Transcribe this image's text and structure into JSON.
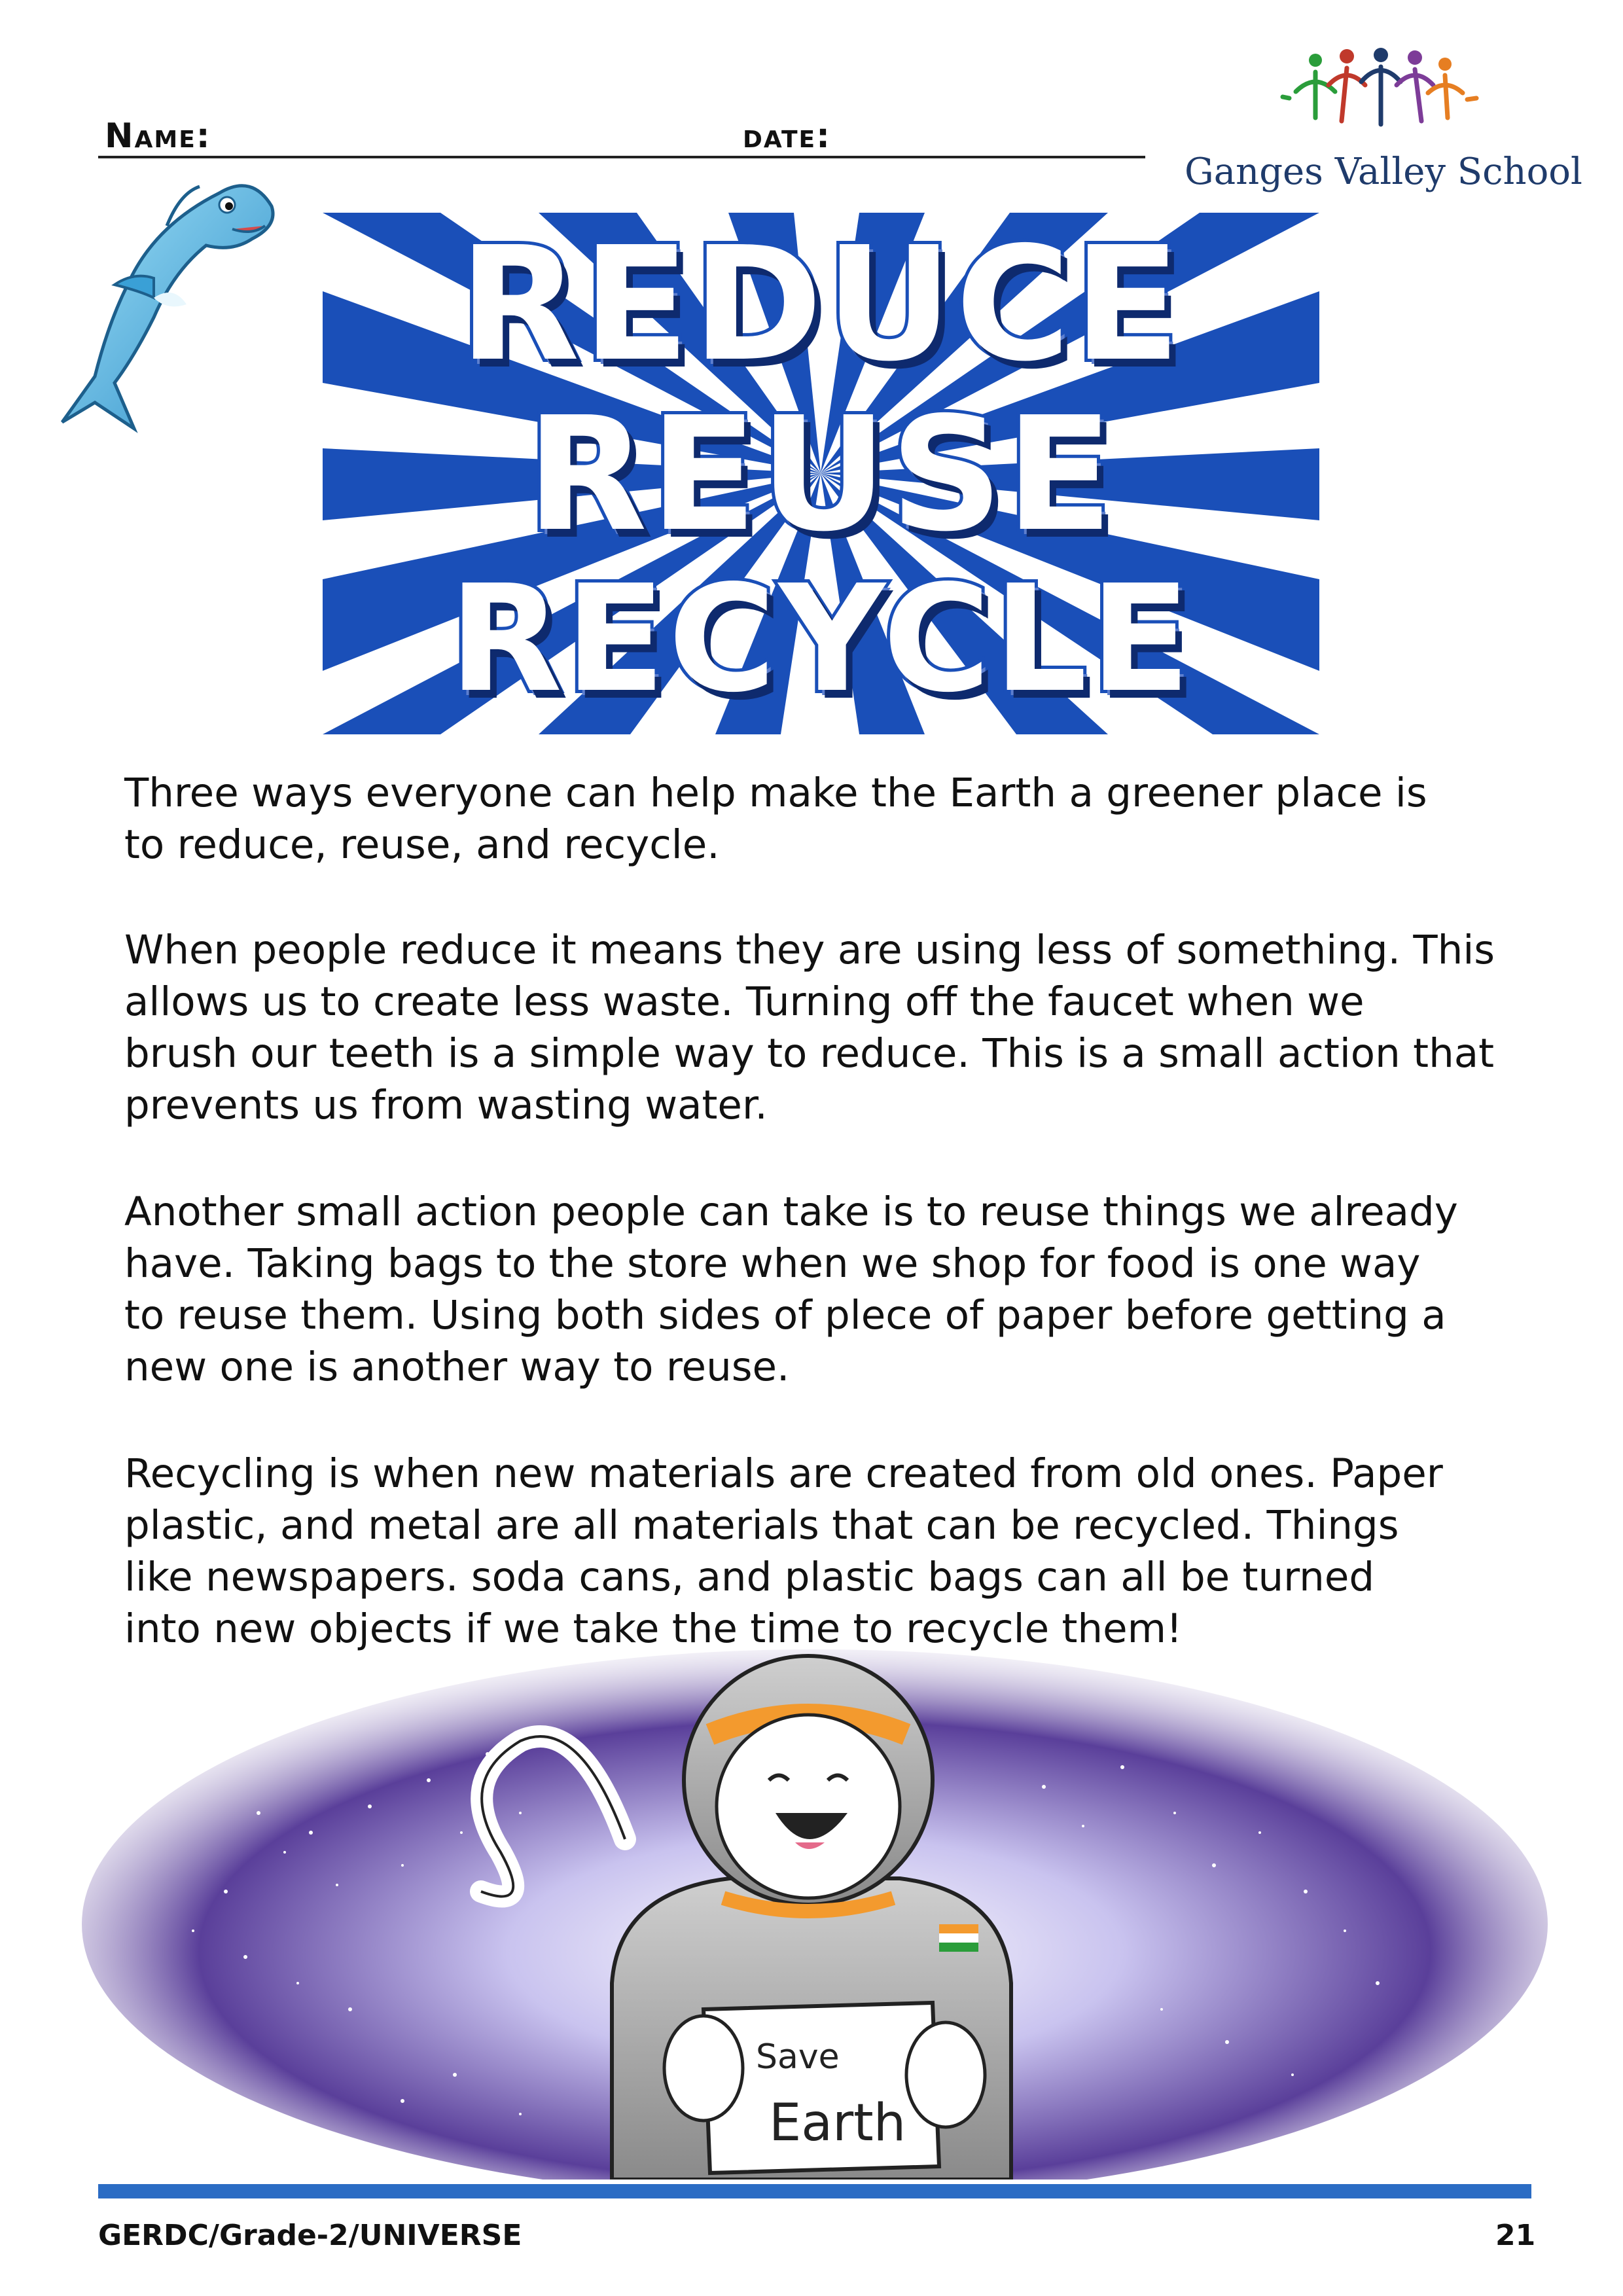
{
  "header": {
    "name_label": "Name:",
    "date_label": "date:"
  },
  "logo": {
    "school_name": "Ganges Valley School"
  },
  "banner": {
    "words": [
      "REDUCE",
      "REUSE",
      "RECYCLE"
    ]
  },
  "paragraphs": [
    [
      "Three ways everyone can help make the Earth a greener place is",
      "to reduce, reuse, and recycle."
    ],
    [
      "When people reduce it means they are using less of something. This",
      "allows us to create less waste. Turning off the faucet when we",
      "brush our teeth is a simple way to reduce. This is a small action that",
      "prevents us from wasting water."
    ],
    [
      "Another small action people can take is to reuse things we already",
      "have. Taking bags to the store when we shop for food is one way",
      "to reuse them. Using both sides of plece of paper before getting a",
      "new one is another way to reuse."
    ],
    [
      "Recycling is when new materials are created from old ones. Paper",
      "plastic, and metal are all materials that can be recycled. Things",
      "like newspapers. soda cans, and plastic bags can all be turned",
      "into new objects if we take the time to recycle them!"
    ]
  ],
  "illustration": {
    "sign_line1": "Save",
    "sign_line2": "Earth"
  },
  "footer": {
    "left": "GERDC/Grade-2/UNIVERSE",
    "page_number": "21"
  },
  "colors": {
    "banner_blue": "#1a4fb8",
    "footer_bar": "#2b6cc4",
    "school_name": "#1f3b6b",
    "helmet_band": "#f39a2e"
  }
}
